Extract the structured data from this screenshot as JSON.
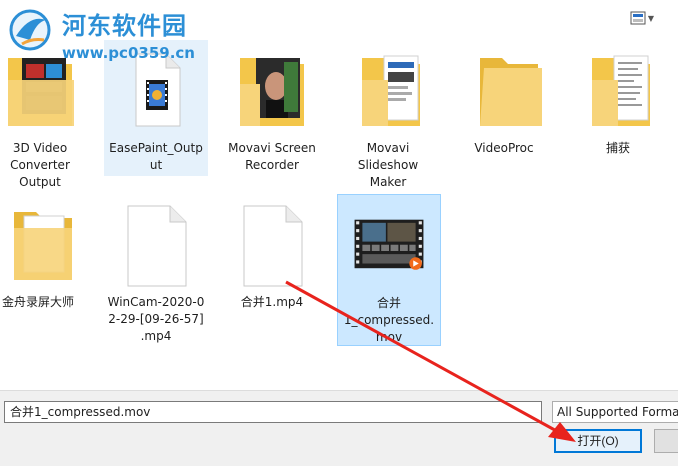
{
  "watermark": {
    "title": "河东软件园",
    "url": "www.pc0359.cn"
  },
  "toolbar": {
    "view_icon": "view-menu-icon"
  },
  "files": [
    {
      "label": "3D Video\nConverter\nOutput",
      "icon": "folder-video-icon"
    },
    {
      "label": "EasePaint_Output",
      "icon": "folder-film-icon"
    },
    {
      "label": "Movavi Screen\nRecorder",
      "icon": "folder-photo-icon"
    },
    {
      "label": "Movavi\nSlideshow\nMaker",
      "icon": "folder-doc-icon"
    },
    {
      "label": "VideoProc",
      "icon": "folder-icon"
    },
    {
      "label": "捕获",
      "icon": "folder-doc-icon"
    },
    {
      "label": "金舟录屏大师",
      "icon": "folder-icon"
    },
    {
      "label": "WinCam-2020-0\n2-29-[09-26-57]\n.mp4",
      "icon": "file-icon"
    },
    {
      "label": "合并1.mp4",
      "icon": "file-icon"
    },
    {
      "label": "合并\n1_compressed.\nmov",
      "icon": "video-thumbnail-icon"
    }
  ],
  "bottom": {
    "filename_value": "合并1_compressed.mov",
    "filter_value": "All Supported Forma",
    "open_label": "打开(O)"
  },
  "colors": {
    "accent": "#0078d7",
    "arrow": "#e8231d",
    "watermark": "#2c8fd6"
  }
}
